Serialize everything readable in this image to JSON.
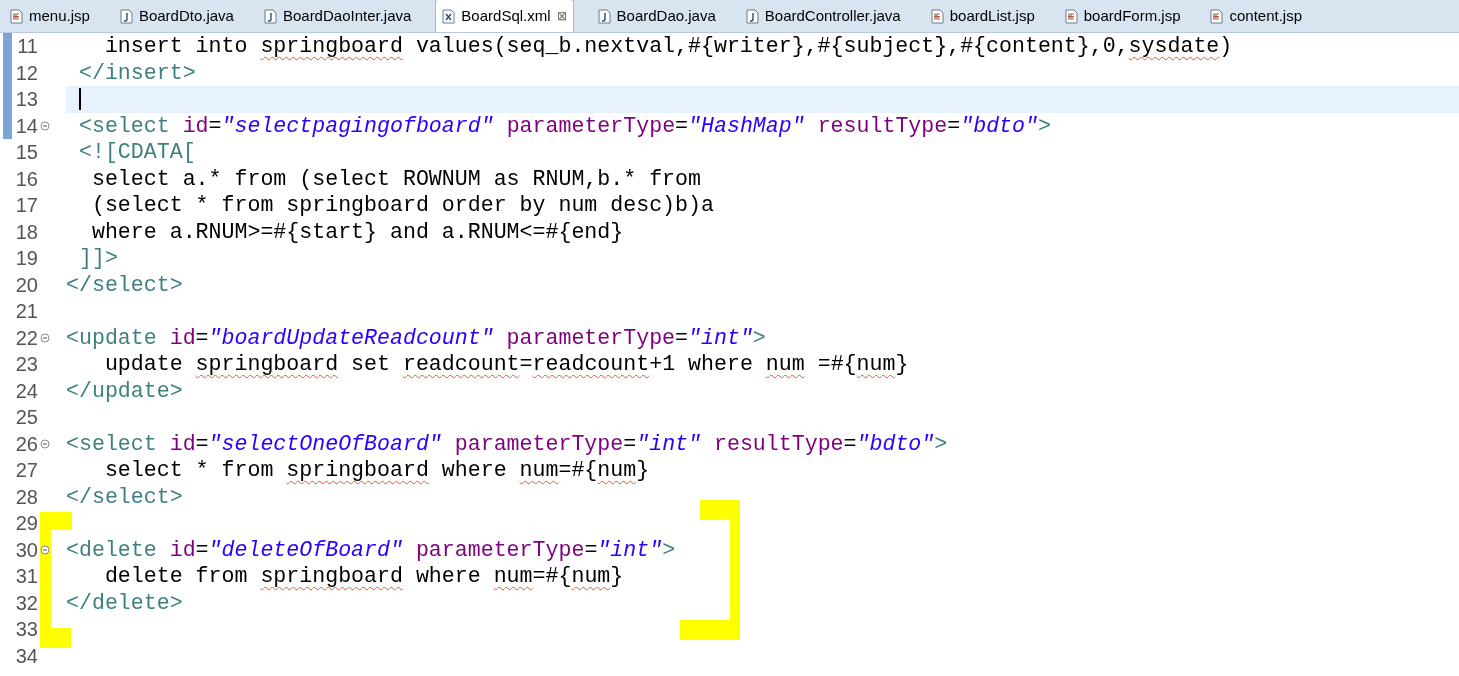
{
  "tabs": [
    {
      "label": "menu.jsp",
      "kind": "jsp",
      "selected": false
    },
    {
      "label": "BoardDto.java",
      "kind": "java",
      "selected": false
    },
    {
      "label": "BoardDaoInter.java",
      "kind": "java",
      "selected": false
    },
    {
      "label": "BoardSql.xml",
      "kind": "xml",
      "selected": true,
      "close": "⊠"
    },
    {
      "label": "BoardDao.java",
      "kind": "java",
      "selected": false
    },
    {
      "label": "BoardController.java",
      "kind": "java",
      "selected": false
    },
    {
      "label": "boardList.jsp",
      "kind": "jsp",
      "selected": false
    },
    {
      "label": "boardForm.jsp",
      "kind": "jsp",
      "selected": false
    },
    {
      "label": "content.jsp",
      "kind": "jsp",
      "selected": false
    }
  ],
  "editor": {
    "lines": [
      {
        "number": "11",
        "fold": false,
        "changed": true,
        "current": false,
        "tokens": [
          {
            "kind": "text",
            "text": "   insert into ",
            "flagged": false
          },
          {
            "kind": "text",
            "text": "springboard",
            "flagged": true
          },
          {
            "kind": "text",
            "text": " values(seq_b.nextval,#{writer},#{subject},#{content},0,",
            "flagged": false
          },
          {
            "kind": "text",
            "text": "sysdate",
            "flagged": true
          },
          {
            "kind": "text",
            "text": ")",
            "flagged": false
          }
        ]
      },
      {
        "number": "12",
        "fold": false,
        "changed": true,
        "current": false,
        "tokens": [
          {
            "kind": "tag",
            "text": " </insert>",
            "flagged": false
          }
        ]
      },
      {
        "number": "13",
        "fold": false,
        "changed": true,
        "current": true
      },
      {
        "number": "14",
        "fold": true,
        "changed": true,
        "current": false,
        "tokens": [
          {
            "kind": "tag",
            "text": " <select ",
            "flagged": false
          },
          {
            "kind": "attr",
            "text": "id",
            "flagged": false
          },
          {
            "kind": "text",
            "text": "=",
            "flagged": false
          },
          {
            "kind": "value",
            "text": "\"selectpagingofboard\"",
            "flagged": false
          },
          {
            "kind": "attr",
            "text": " parameterType",
            "flagged": false
          },
          {
            "kind": "text",
            "text": "=",
            "flagged": false
          },
          {
            "kind": "value",
            "text": "\"HashMap\"",
            "flagged": false
          },
          {
            "kind": "attr",
            "text": " resultType",
            "flagged": false
          },
          {
            "kind": "text",
            "text": "=",
            "flagged": false
          },
          {
            "kind": "value",
            "text": "\"bdto\"",
            "flagged": false
          },
          {
            "kind": "tag",
            "text": ">",
            "flagged": false
          }
        ]
      },
      {
        "number": "15",
        "fold": false,
        "changed": false,
        "current": false,
        "tokens": [
          {
            "kind": "tag",
            "text": " <![CDATA[",
            "flagged": false
          }
        ]
      },
      {
        "number": "16",
        "fold": false,
        "changed": false,
        "current": false,
        "tokens": [
          {
            "kind": "text",
            "text": "  select a.* from (select ROWNUM as RNUM,b.* from",
            "flagged": false
          }
        ]
      },
      {
        "number": "17",
        "fold": false,
        "changed": false,
        "current": false,
        "tokens": [
          {
            "kind": "text",
            "text": "  (select * from springboard order by num desc)b)a",
            "flagged": false
          }
        ]
      },
      {
        "number": "18",
        "fold": false,
        "changed": false,
        "current": false,
        "tokens": [
          {
            "kind": "text",
            "text": "  where a.RNUM>=#{start} and a.RNUM<=#{end}",
            "flagged": false
          }
        ]
      },
      {
        "number": "19",
        "fold": false,
        "changed": false,
        "current": false,
        "tokens": [
          {
            "kind": "tag",
            "text": " ]]>",
            "flagged": false
          }
        ]
      },
      {
        "number": "20",
        "fold": false,
        "changed": false,
        "current": false,
        "tokens": [
          {
            "kind": "tag",
            "text": "</select>",
            "flagged": false
          }
        ]
      },
      {
        "number": "21",
        "fold": false,
        "changed": false,
        "current": false
      },
      {
        "number": "22",
        "fold": true,
        "changed": false,
        "current": false,
        "tokens": [
          {
            "kind": "tag",
            "text": "<update ",
            "flagged": false
          },
          {
            "kind": "attr",
            "text": "id",
            "flagged": false
          },
          {
            "kind": "text",
            "text": "=",
            "flagged": false
          },
          {
            "kind": "value",
            "text": "\"boardUpdateReadcount\"",
            "flagged": false
          },
          {
            "kind": "attr",
            "text": " parameterType",
            "flagged": false
          },
          {
            "kind": "text",
            "text": "=",
            "flagged": false
          },
          {
            "kind": "value",
            "text": "\"int\"",
            "flagged": false
          },
          {
            "kind": "tag",
            "text": ">",
            "flagged": false
          }
        ]
      },
      {
        "number": "23",
        "fold": false,
        "changed": false,
        "current": false,
        "tokens": [
          {
            "kind": "text",
            "text": "   update ",
            "flagged": false
          },
          {
            "kind": "text",
            "text": "springboard",
            "flagged": true
          },
          {
            "kind": "text",
            "text": " set ",
            "flagged": false
          },
          {
            "kind": "text",
            "text": "readcount",
            "flagged": true
          },
          {
            "kind": "text",
            "text": "=",
            "flagged": false
          },
          {
            "kind": "text",
            "text": "readcount",
            "flagged": true
          },
          {
            "kind": "text",
            "text": "+1 where ",
            "flagged": false
          },
          {
            "kind": "text",
            "text": "num",
            "flagged": true
          },
          {
            "kind": "text",
            "text": " =#{",
            "flagged": false
          },
          {
            "kind": "text",
            "text": "num",
            "flagged": true
          },
          {
            "kind": "text",
            "text": "}",
            "flagged": false
          }
        ]
      },
      {
        "number": "24",
        "fold": false,
        "changed": false,
        "current": false,
        "tokens": [
          {
            "kind": "tag",
            "text": "</update>",
            "flagged": false
          }
        ]
      },
      {
        "number": "25",
        "fold": false,
        "changed": false,
        "current": false
      },
      {
        "number": "26",
        "fold": true,
        "changed": false,
        "current": false,
        "tokens": [
          {
            "kind": "tag",
            "text": "<select ",
            "flagged": false
          },
          {
            "kind": "attr",
            "text": "id",
            "flagged": false
          },
          {
            "kind": "text",
            "text": "=",
            "flagged": false
          },
          {
            "kind": "value",
            "text": "\"selectOneOfBoard\"",
            "flagged": false
          },
          {
            "kind": "attr",
            "text": " parameterType",
            "flagged": false
          },
          {
            "kind": "text",
            "text": "=",
            "flagged": false
          },
          {
            "kind": "value",
            "text": "\"int\"",
            "flagged": false
          },
          {
            "kind": "attr",
            "text": " resultType",
            "flagged": false
          },
          {
            "kind": "text",
            "text": "=",
            "flagged": false
          },
          {
            "kind": "value",
            "text": "\"bdto\"",
            "flagged": false
          },
          {
            "kind": "tag",
            "text": ">",
            "flagged": false
          }
        ]
      },
      {
        "number": "27",
        "fold": false,
        "changed": false,
        "current": false,
        "tokens": [
          {
            "kind": "text",
            "text": "   select * from ",
            "flagged": false
          },
          {
            "kind": "text",
            "text": "springboard",
            "flagged": true
          },
          {
            "kind": "text",
            "text": " where ",
            "flagged": false
          },
          {
            "kind": "text",
            "text": "num",
            "flagged": true
          },
          {
            "kind": "text",
            "text": "=#{",
            "flagged": false
          },
          {
            "kind": "text",
            "text": "num",
            "flagged": true
          },
          {
            "kind": "text",
            "text": "}",
            "flagged": false
          }
        ]
      },
      {
        "number": "28",
        "fold": false,
        "changed": false,
        "current": false,
        "tokens": [
          {
            "kind": "tag",
            "text": "</select>",
            "flagged": false
          }
        ]
      },
      {
        "number": "29",
        "fold": false,
        "changed": false,
        "current": false
      },
      {
        "number": "30",
        "fold": true,
        "changed": false,
        "current": false,
        "tokens": [
          {
            "kind": "tag",
            "text": "<delete ",
            "flagged": false
          },
          {
            "kind": "attr",
            "text": "id",
            "flagged": false
          },
          {
            "kind": "text",
            "text": "=",
            "flagged": false
          },
          {
            "kind": "value",
            "text": "\"deleteOfBoard\"",
            "flagged": false
          },
          {
            "kind": "attr",
            "text": " parameterType",
            "flagged": false
          },
          {
            "kind": "text",
            "text": "=",
            "flagged": false
          },
          {
            "kind": "value",
            "text": "\"int\"",
            "flagged": false
          },
          {
            "kind": "tag",
            "text": ">",
            "flagged": false
          }
        ]
      },
      {
        "number": "31",
        "fold": false,
        "changed": false,
        "current": false,
        "tokens": [
          {
            "kind": "text",
            "text": "   delete from ",
            "flagged": false
          },
          {
            "kind": "text",
            "text": "springboard",
            "flagged": true
          },
          {
            "kind": "text",
            "text": " where ",
            "flagged": false
          },
          {
            "kind": "text",
            "text": "num",
            "flagged": true
          },
          {
            "kind": "text",
            "text": "=#{",
            "flagged": false
          },
          {
            "kind": "text",
            "text": "num",
            "flagged": true
          },
          {
            "kind": "text",
            "text": "}",
            "flagged": false
          }
        ]
      },
      {
        "number": "32",
        "fold": false,
        "changed": false,
        "current": false,
        "tokens": [
          {
            "kind": "tag",
            "text": "</delete>",
            "flagged": false
          }
        ]
      },
      {
        "number": "33",
        "fold": false,
        "changed": false,
        "current": false
      },
      {
        "number": "34",
        "fold": false,
        "changed": false,
        "current": false
      }
    ]
  }
}
